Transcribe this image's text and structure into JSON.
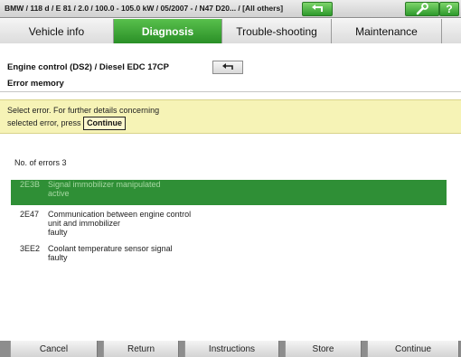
{
  "title_bar": {
    "title": "BMW / 118 d / E 81 / 2.0 / 100.0 - 105.0 kW / 05/2007 - / N47 D20... / [All others]",
    "back_icon": "back-arrow-icon",
    "tool_icon": "wrench-icon",
    "help_label": "?"
  },
  "tabs": [
    {
      "label": "Vehicle info"
    },
    {
      "label": "Diagnosis"
    },
    {
      "label": "Trouble-shooting"
    },
    {
      "label": "Maintenance"
    },
    {
      "label": ""
    }
  ],
  "header": {
    "path": "Engine control (DS2) / Diesel EDC 17CP",
    "subtitle": "Error memory"
  },
  "info": {
    "line1": "Select error. For further details concerning",
    "line2": "selected error, press",
    "continue_label": "Continue"
  },
  "error_count": "No. of errors 3",
  "errors": [
    {
      "code": "2E3B",
      "line1": "Signal immobilizer manipulated",
      "line2": "active",
      "line3": ""
    },
    {
      "code": "2E47",
      "line1": "Communication between engine control",
      "line2": "unit and immobilizer",
      "line3": "faulty"
    },
    {
      "code": "3EE2",
      "line1": "Coolant temperature sensor signal",
      "line2": "faulty",
      "line3": ""
    }
  ],
  "bottom_buttons": {
    "cancel": "Cancel",
    "return": "Return",
    "instructions": "Instructions",
    "store": "Store",
    "continue": "Continue"
  },
  "colors": {
    "accent_green": "#2f8f36",
    "info_yellow": "#f6f3b6"
  }
}
